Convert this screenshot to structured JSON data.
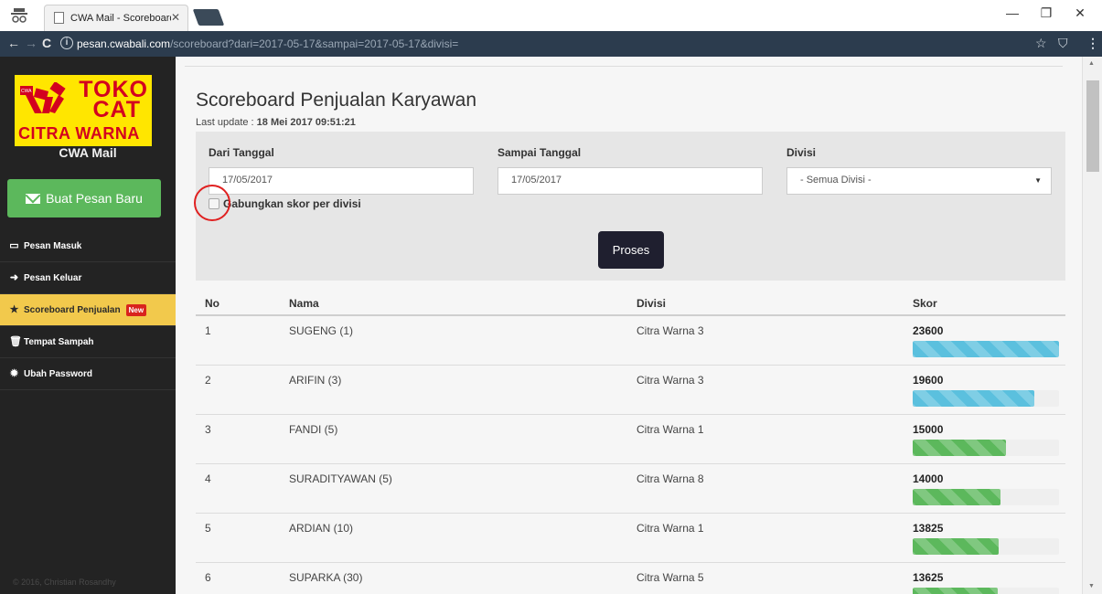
{
  "browser": {
    "tab_title": "CWA Mail - Scoreboard P",
    "url_host": "pesan.cwabali.com",
    "url_path": "/scoreboard?dari=2017-05-17&sampai=2017-05-17&divisi="
  },
  "sidebar": {
    "logo": {
      "line1": "TOKO",
      "line2": "CAT",
      "line3": "CITRA WARNA",
      "brush_text": "CWA"
    },
    "app_name": "CWA Mail",
    "new_message_label": "Buat Pesan Baru",
    "menu": [
      {
        "label": "Pesan Masuk",
        "icon": "inbox-icon"
      },
      {
        "label": "Pesan Keluar",
        "icon": "sign-out-icon"
      },
      {
        "label": "Scoreboard Penjualan",
        "icon": "star-icon",
        "badge": "New",
        "active": true
      },
      {
        "label": "Tempat Sampah",
        "icon": "trash-icon"
      },
      {
        "label": "Ubah Password",
        "icon": "gear-icon"
      }
    ],
    "footer": "© 2016, Christian Rosandhy"
  },
  "main": {
    "title": "Scoreboard Penjualan Karyawan",
    "last_update_label": "Last update :",
    "last_update_value": "18 Mei 2017 09:51:21",
    "filter": {
      "from_label": "Dari Tanggal",
      "from_value": "17/05/2017",
      "to_label": "Sampai Tanggal",
      "to_value": "17/05/2017",
      "division_label": "Divisi",
      "division_value": "- Semua Divisi -",
      "combine_label": "Gabungkan skor per divisi",
      "combine_checked": false,
      "submit_label": "Proses"
    },
    "table": {
      "headers": {
        "no": "No",
        "name": "Nama",
        "division": "Divisi",
        "score": "Skor"
      },
      "rows": [
        {
          "no": "1",
          "name": "SUGENG (1)",
          "division": "Citra Warna 3",
          "score": "23600",
          "fraction": 1.0,
          "color": "info"
        },
        {
          "no": "2",
          "name": "ARIFIN (3)",
          "division": "Citra Warna 3",
          "score": "19600",
          "fraction": 0.83,
          "color": "info"
        },
        {
          "no": "3",
          "name": "FANDI (5)",
          "division": "Citra Warna 1",
          "score": "15000",
          "fraction": 0.64,
          "color": "success"
        },
        {
          "no": "4",
          "name": "SURADITYAWAN (5)",
          "division": "Citra Warna 8",
          "score": "14000",
          "fraction": 0.6,
          "color": "success"
        },
        {
          "no": "5",
          "name": "ARDIAN (10)",
          "division": "Citra Warna 1",
          "score": "13825",
          "fraction": 0.59,
          "color": "success"
        },
        {
          "no": "6",
          "name": "SUPARKA (30)",
          "division": "Citra Warna 5",
          "score": "13625",
          "fraction": 0.58,
          "color": "success"
        }
      ]
    }
  },
  "colors": {
    "sidebar_bg": "#232323",
    "active_menu": "#f2c94c",
    "new_button": "#5cb85c",
    "proses_button": "#1f1f2f",
    "bar_info": "#5bc0de",
    "bar_success": "#5cb85c",
    "badge": "#d9231d"
  }
}
